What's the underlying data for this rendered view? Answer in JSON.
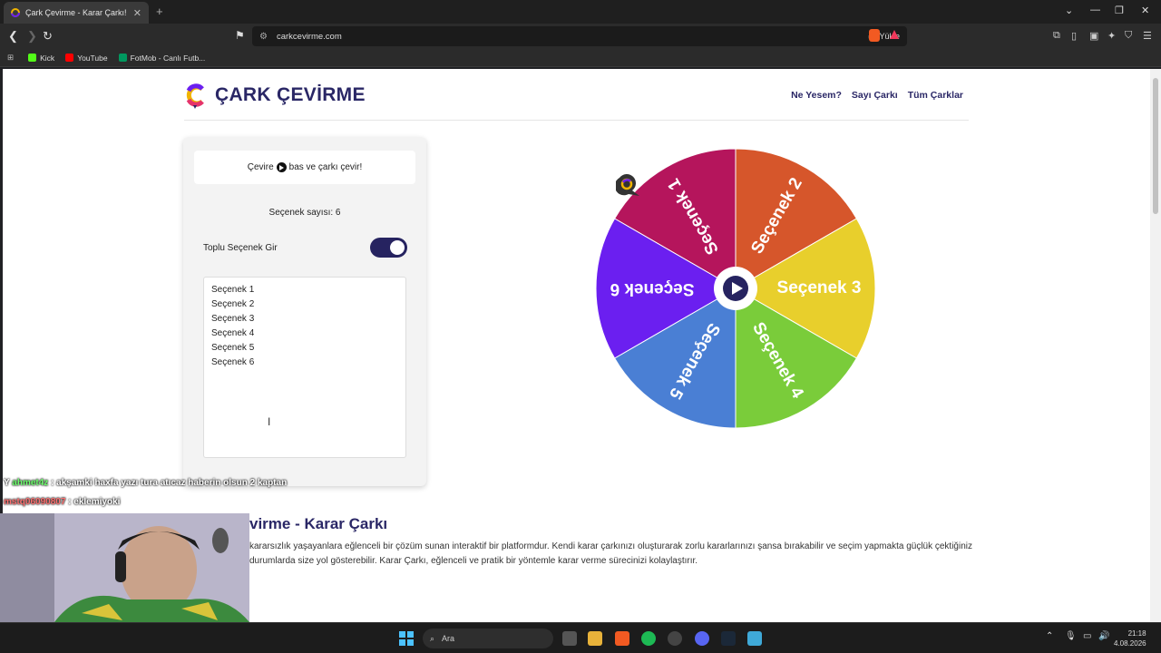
{
  "browser": {
    "tab_title": "Çark Çevirme - Karar Çarkı!",
    "url": "carkcevirme.com",
    "load_label": "Yükle",
    "bookmarks": [
      {
        "label": "Kick",
        "color": "#53fc18"
      },
      {
        "label": "YouTube",
        "color": "#ff0000"
      },
      {
        "label": "FotMob - Canlı Futb...",
        "color": "#00985f"
      }
    ]
  },
  "site": {
    "logo_text": "ÇARK ÇEVİRME",
    "nav": [
      "Ne Yesem?",
      "Sayı Çarkı",
      "Tüm Çarklar"
    ]
  },
  "panel": {
    "hint_prefix": "Çevire",
    "hint_suffix": "bas ve çarkı çevir!",
    "count_label": "Seçenek sayısı: 6",
    "bulk_label": "Toplu Seçenek Gir",
    "bulk_enabled": true,
    "options": [
      "Seçenek 1",
      "Seçenek 2",
      "Seçenek 3",
      "Seçenek 4",
      "Seçenek 5",
      "Seçenek 6"
    ]
  },
  "wheel": {
    "segments": [
      {
        "label": "Seçenek 1",
        "color": "#b5155c"
      },
      {
        "label": "Seçenek 2",
        "color": "#d6562b"
      },
      {
        "label": "Seçenek 3",
        "color": "#e8cf2c"
      },
      {
        "label": "Seçenek 4",
        "color": "#7acc3a"
      },
      {
        "label": "Seçenek 5",
        "color": "#4a7fd4"
      },
      {
        "label": "Seçenek 6",
        "color": "#6b1ff0"
      }
    ]
  },
  "content": {
    "title": "virme - Karar Çarkı",
    "paragraph": "kararsızlık yaşayanlara eğlenceli bir çözüm sunan interaktif bir platformdur. Kendi karar çarkınızı oluşturarak zorlu kararlarınızı şansa bırakabilir ve seçim yapmakta güçlük çektiğiniz durumlarda size yol gösterebilir. Karar Çarkı, eğlenceli ve pratik bir yöntemle karar verme sürecinizi kolaylaştırır."
  },
  "chat": [
    {
      "user": "ahmet4z",
      "message": ": akşamki haxfa yazı tura atıcaz haberin olsun 2 kaptan"
    },
    {
      "user": "mstq06090807",
      "message": ": eklemiyoki"
    }
  ],
  "taskbar": {
    "search_placeholder": "Ara",
    "time": "21:18",
    "date": "4.08.2026"
  }
}
